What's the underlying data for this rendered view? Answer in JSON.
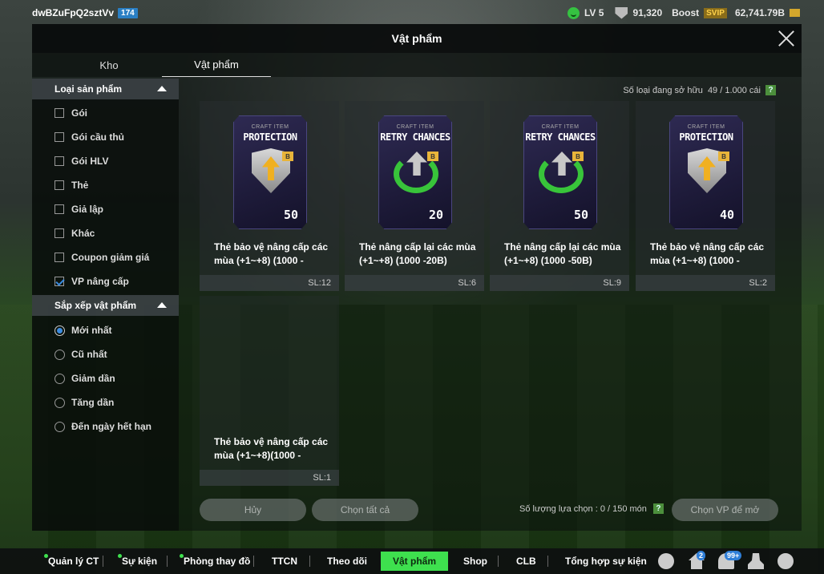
{
  "topbar": {
    "username": "dwBZuFpQ2sztVv",
    "level_badge": "174",
    "lv": "LV 5",
    "points": "91,320",
    "boost": "Boost",
    "svip": "SVIP",
    "bp": "62,741.79B"
  },
  "dialog": {
    "title": "Vật phẩm",
    "tabs": [
      "Kho",
      "Vật phẩm"
    ]
  },
  "filters": {
    "type_header": "Loại sản phẩm",
    "types": [
      {
        "label": "Gói",
        "checked": false
      },
      {
        "label": "Gói cầu thủ",
        "checked": false
      },
      {
        "label": "Gói HLV",
        "checked": false
      },
      {
        "label": "Thẻ",
        "checked": false
      },
      {
        "label": "Giả lập",
        "checked": false
      },
      {
        "label": "Khác",
        "checked": false
      },
      {
        "label": "Coupon giảm giá",
        "checked": false
      },
      {
        "label": "VP nâng cấp",
        "checked": true
      }
    ],
    "sort_header": "Sắp xếp vật phẩm",
    "sorts": [
      {
        "label": "Mới nhất",
        "checked": true
      },
      {
        "label": "Cũ nhất",
        "checked": false
      },
      {
        "label": "Giảm dần",
        "checked": false
      },
      {
        "label": "Tăng dần",
        "checked": false
      },
      {
        "label": "Đến ngày hết hạn",
        "checked": false
      }
    ]
  },
  "owned": {
    "label": "Số loại đang sở hữu",
    "value": "49 / 1.000 cái",
    "help": "?"
  },
  "items": [
    {
      "craft": "CRAFT ITEM",
      "art_title": "PROTECTION",
      "kind": "protection",
      "art_num": "50",
      "badge": "B",
      "name": "Thẻ bảo vệ nâng cấp các mùa (+1~+8) (1000 -",
      "qty": "SL:12"
    },
    {
      "craft": "CRAFT ITEM",
      "art_title": "RETRY CHANCES",
      "kind": "retry",
      "art_num": "20",
      "badge": "B",
      "name": "Thẻ nâng cấp lại các mùa (+1~+8) (1000 -20B)",
      "qty": "SL:6"
    },
    {
      "craft": "CRAFT ITEM",
      "art_title": "RETRY CHANCES",
      "kind": "retry",
      "art_num": "50",
      "badge": "B",
      "name": "Thẻ nâng cấp lại các mùa (+1~+8) (1000 -50B)",
      "qty": "SL:9"
    },
    {
      "craft": "CRAFT ITEM",
      "art_title": "PROTECTION",
      "kind": "protection",
      "art_num": "40",
      "badge": "B",
      "name": "Thẻ bảo vệ nâng cấp các mùa (+1~+8) (1000 -",
      "qty": "SL:2"
    },
    {
      "craft": "",
      "art_title": "",
      "kind": "empty",
      "art_num": "",
      "badge": "",
      "name": "Thẻ bảo vệ nâng cấp các mùa (+1~+8)(1000 -",
      "qty": "SL:1"
    }
  ],
  "actions": {
    "cancel": "Hủy",
    "select_all": "Chọn tất cả",
    "selection_count": "Số lượng lựa chọn : 0 / 150 món",
    "help": "?",
    "open": "Chọn VP để mở"
  },
  "nav": {
    "items": [
      "Quản lý CT",
      "Sự kiện",
      "Phòng thay đồ",
      "TTCN",
      "Theo dõi",
      "Vật phẩm",
      "Shop",
      "CLB",
      "Tổng hợp sự kiện"
    ],
    "active": "Vật phẩm",
    "home_badge": "2",
    "bell_badge": "99+"
  }
}
